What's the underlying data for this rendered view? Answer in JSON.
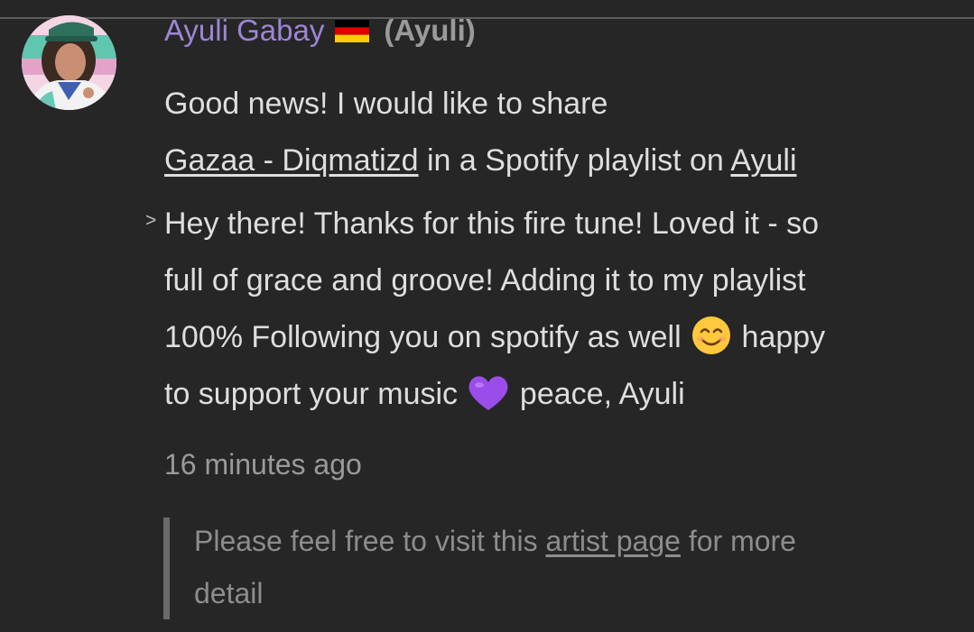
{
  "comment": {
    "author_name": "Ayuli Gabay",
    "flag_icon": "germany-flag-icon",
    "username": "(Ayuli)",
    "intro": {
      "text_1": "Good news! I would like to share",
      "track_link": "Gazaa - Diqmatizd",
      "text_2": " in a Spotify playlist on ",
      "playlist_link": "Ayuli"
    },
    "quote_marker": ">",
    "quote": {
      "line_1": "Hey there! Thanks for this fire tune! Loved it - so",
      "line_2": "full of grace and groove! Adding it to my playlist",
      "line_3_a": "100% Following you on spotify as well ",
      "emoji_1": "smiling-face-icon",
      "line_3_b": " happy",
      "line_4_a": "to support your music ",
      "emoji_2": "purple-heart-icon",
      "line_4_b": " peace, Ayuli"
    },
    "timestamp": "16 minutes ago",
    "note": {
      "text_1": "Please feel free to visit this ",
      "link": "artist page",
      "text_2": " for more",
      "text_3": "detail"
    }
  },
  "colors": {
    "background": "#262626",
    "author_name": "#9d85d6",
    "body_text": "#dedede",
    "muted_text": "#9a9a9a",
    "note_text": "#8d8d8d"
  }
}
